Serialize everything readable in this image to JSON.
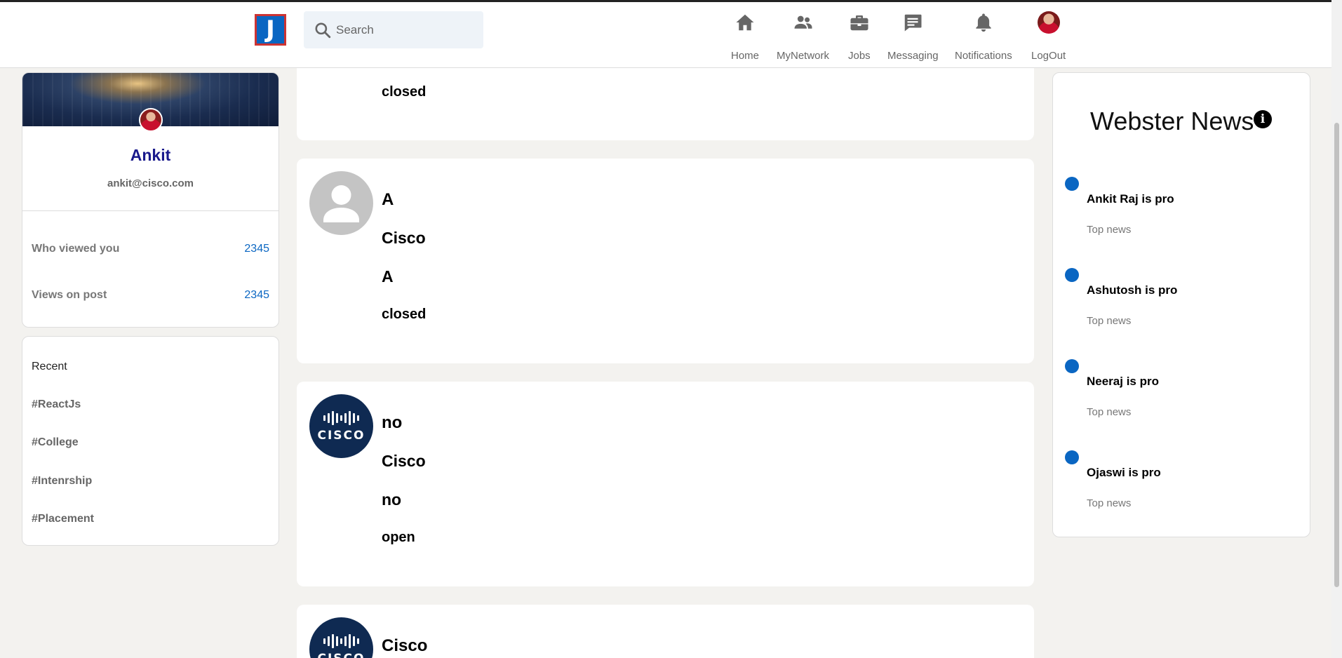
{
  "header": {
    "logo_letter": "J",
    "search_placeholder": "Search",
    "nav": [
      {
        "label": "Home",
        "icon": "home-icon"
      },
      {
        "label": "MyNetwork",
        "icon": "people-icon"
      },
      {
        "label": "Jobs",
        "icon": "briefcase-icon"
      },
      {
        "label": "Messaging",
        "icon": "message-icon"
      },
      {
        "label": "Notifications",
        "icon": "bell-icon"
      },
      {
        "label": "LogOut",
        "icon": "avatar"
      }
    ]
  },
  "profile": {
    "name": "Ankit",
    "email": "ankit@cisco.com",
    "stats": [
      {
        "label": "Who viewed you",
        "value": "2345"
      },
      {
        "label": "Views on post",
        "value": "2345"
      }
    ]
  },
  "recent": {
    "title": "Recent",
    "tags": [
      "#ReactJs",
      "#College",
      "#Intenrship",
      "#Placement"
    ]
  },
  "feed": {
    "posts": [
      {
        "lines": [
          "closed"
        ]
      },
      {
        "avatar": "default-user-avatar",
        "lines": [
          "A",
          "Cisco",
          "A",
          "closed"
        ]
      },
      {
        "avatar": "cisco-logo-avatar",
        "lines": [
          "no",
          "Cisco",
          "no",
          "open"
        ]
      },
      {
        "avatar": "cisco-logo-avatar",
        "lines": [
          "Cisco"
        ]
      }
    ]
  },
  "news": {
    "title": "Webster News",
    "items": [
      {
        "headline": "Ankit Raj is pro",
        "sub": "Top news"
      },
      {
        "headline": "Ashutosh is pro",
        "sub": "Top news"
      },
      {
        "headline": "Neeraj is pro",
        "sub": "Top news"
      },
      {
        "headline": "Ojaswi is pro",
        "sub": "Top news"
      }
    ]
  },
  "colors": {
    "accent": "#0a66c2",
    "background": "#f3f2ef",
    "name": "#1a1a8c"
  }
}
